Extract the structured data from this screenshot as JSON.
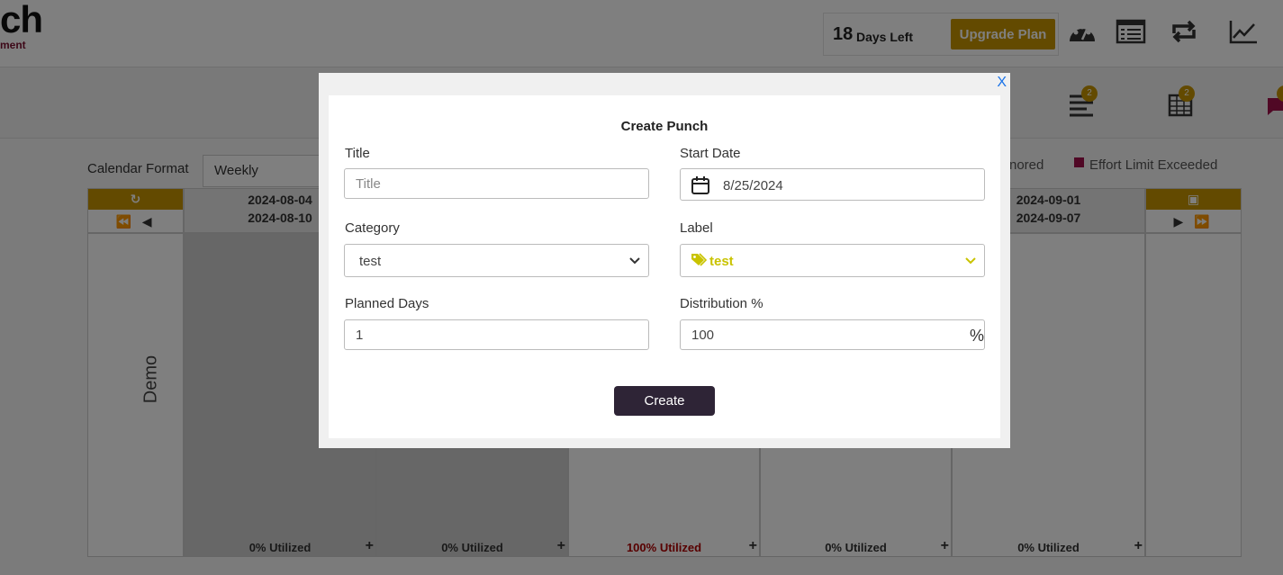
{
  "header": {
    "logo_text": "ch",
    "logo_subtext": "ment",
    "days_left_number": "18",
    "days_left_label": "Days Left",
    "upgrade_label": "Upgrade Plan"
  },
  "subheader": {
    "badge_1": "2",
    "badge_2": "2"
  },
  "toolbar": {
    "calendar_format_label": "Calendar Format",
    "calendar_format_value": "Weekly",
    "legend_ignored": "nored",
    "legend_effort": "Effort Limit Exceeded"
  },
  "calendar": {
    "row_name": "Demo",
    "weeks": [
      {
        "start": "2024-08-04",
        "end": "2024-08-10",
        "utilized": "0% Utilized"
      },
      {
        "start": "",
        "end": "",
        "utilized": "0% Utilized"
      },
      {
        "start": "",
        "end": "",
        "utilized": "100% Utilized"
      },
      {
        "start": "",
        "end": "",
        "utilized": "0% Utilized"
      },
      {
        "start": "2024-09-01",
        "end": "2024-09-07",
        "utilized": "0% Utilized"
      }
    ],
    "plus": "+"
  },
  "modal": {
    "close_label": "X",
    "title": "Create Punch",
    "title_label": "Title",
    "title_placeholder": "Title",
    "start_date_label": "Start Date",
    "start_date_value": "8/25/2024",
    "category_label": "Category",
    "category_value": "test",
    "label_label": "Label",
    "label_value": "test",
    "planned_days_label": "Planned Days",
    "planned_days_value": "1",
    "distribution_label": "Distribution %",
    "distribution_value": "100",
    "percent_symbol": "%",
    "create_label": "Create"
  }
}
